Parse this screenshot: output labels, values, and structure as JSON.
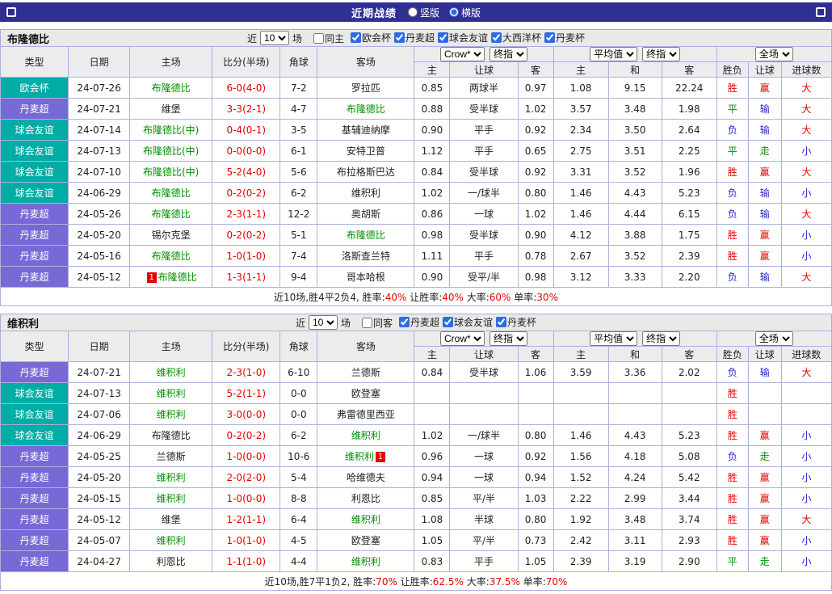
{
  "top_bar": {
    "title": "近期战绩",
    "views": [
      {
        "label": "竖版",
        "selected": false
      },
      {
        "label": "横版",
        "selected": true
      }
    ]
  },
  "icons": {
    "topbar_left": "square-outline-icon",
    "topbar_right": "square-outline-icon"
  },
  "colors": {
    "topbar_bg": "#2f2f94",
    "type_badges": {
      "欧会杯": "#00aca6",
      "丹麦超": "#7769d6",
      "球会友谊": "#00aca6"
    },
    "result_text": {
      "胜": "#e60000",
      "赢": "#e60000",
      "大": "#e60000",
      "平": "#008f00",
      "走": "#008f00",
      "负": "#2424d6",
      "输": "#2424d6",
      "小": "#2424d6"
    },
    "focus_team": "#008f00",
    "score": "#e60000"
  },
  "header_labels": {
    "type": "类型",
    "date": "日期",
    "home": "主场",
    "score": "比分(半场)",
    "corner": "角球",
    "away": "客场",
    "odds_home": "主",
    "odds_handicap": "让球",
    "odds_away": "客",
    "euro_home": "主",
    "euro_draw": "和",
    "euro_away": "客",
    "res_wdl": "胜负",
    "res_handicap": "让球",
    "res_goals": "进球数"
  },
  "sections": [
    {
      "team": "布隆德比",
      "recent": {
        "prefix": "近",
        "count": "10",
        "suffix": "场"
      },
      "venue_filter": {
        "label": "同主",
        "checked": false
      },
      "league_filters": [
        {
          "label": "欧会杯",
          "checked": true
        },
        {
          "label": "丹麦超",
          "checked": true
        },
        {
          "label": "球会友谊",
          "checked": true
        },
        {
          "label": "大西洋杯",
          "checked": true
        },
        {
          "label": "丹麦杯",
          "checked": true
        }
      ],
      "selectors": {
        "odds_source": "Crow*",
        "odds_stage": "终指",
        "euro_source": "平均值",
        "euro_stage": "终指",
        "scope": "全场"
      },
      "rows": [
        {
          "type": "欧会杯",
          "date": "24-07-26",
          "home": {
            "name": "布隆德比",
            "focus": true
          },
          "score": "6-0(4-0)",
          "corner": "7-2",
          "away": {
            "name": "罗拉匹",
            "focus": false
          },
          "odds": [
            "0.85",
            "两球半",
            "0.97",
            "1.08",
            "9.15",
            "22.24"
          ],
          "results": [
            "胜",
            "赢",
            "大"
          ]
        },
        {
          "type": "丹麦超",
          "date": "24-07-21",
          "home": {
            "name": "维堡",
            "focus": false
          },
          "score": "3-3(2-1)",
          "corner": "4-7",
          "away": {
            "name": "布隆德比",
            "focus": true
          },
          "odds": [
            "0.88",
            "受半球",
            "1.02",
            "3.57",
            "3.48",
            "1.98"
          ],
          "results": [
            "平",
            "输",
            "大"
          ]
        },
        {
          "type": "球会友谊",
          "date": "24-07-14",
          "home": {
            "name": "布隆德比(中)",
            "focus": true
          },
          "score": "0-4(0-1)",
          "corner": "3-5",
          "away": {
            "name": "基辅迪纳摩",
            "focus": false
          },
          "odds": [
            "0.90",
            "平手",
            "0.92",
            "2.34",
            "3.50",
            "2.64"
          ],
          "results": [
            "负",
            "输",
            "大"
          ]
        },
        {
          "type": "球会友谊",
          "date": "24-07-13",
          "home": {
            "name": "布隆德比(中)",
            "focus": true
          },
          "score": "0-0(0-0)",
          "corner": "6-1",
          "away": {
            "name": "安特卫普",
            "focus": false
          },
          "odds": [
            "1.12",
            "平手",
            "0.65",
            "2.75",
            "3.51",
            "2.25"
          ],
          "results": [
            "平",
            "走",
            "小"
          ]
        },
        {
          "type": "球会友谊",
          "date": "24-07-10",
          "home": {
            "name": "布隆德比(中)",
            "focus": true
          },
          "score": "5-2(4-0)",
          "corner": "5-6",
          "away": {
            "name": "布拉格斯巴达",
            "focus": false
          },
          "odds": [
            "0.84",
            "受半球",
            "0.92",
            "3.31",
            "3.52",
            "1.96"
          ],
          "results": [
            "胜",
            "赢",
            "大"
          ]
        },
        {
          "type": "球会友谊",
          "date": "24-06-29",
          "home": {
            "name": "布隆德比",
            "focus": true
          },
          "score": "0-2(0-2)",
          "corner": "6-2",
          "away": {
            "name": "维积利",
            "focus": false
          },
          "odds": [
            "1.02",
            "一/球半",
            "0.80",
            "1.46",
            "4.43",
            "5.23"
          ],
          "results": [
            "负",
            "输",
            "小"
          ]
        },
        {
          "type": "丹麦超",
          "date": "24-05-26",
          "home": {
            "name": "布隆德比",
            "focus": true
          },
          "score": "2-3(1-1)",
          "corner": "12-2",
          "away": {
            "name": "奥胡斯",
            "focus": false
          },
          "odds": [
            "0.86",
            "一球",
            "1.02",
            "1.46",
            "4.44",
            "6.15"
          ],
          "results": [
            "负",
            "输",
            "大"
          ]
        },
        {
          "type": "丹麦超",
          "date": "24-05-20",
          "home": {
            "name": "锡尔克堡",
            "focus": false
          },
          "score": "0-2(0-2)",
          "corner": "5-1",
          "away": {
            "name": "布隆德比",
            "focus": true
          },
          "odds": [
            "0.98",
            "受半球",
            "0.90",
            "4.12",
            "3.88",
            "1.75"
          ],
          "results": [
            "胜",
            "赢",
            "小"
          ]
        },
        {
          "type": "丹麦超",
          "date": "24-05-16",
          "home": {
            "name": "布隆德比",
            "focus": true
          },
          "score": "1-0(1-0)",
          "corner": "7-4",
          "away": {
            "name": "洛斯查兰特",
            "focus": false
          },
          "odds": [
            "1.11",
            "平手",
            "0.78",
            "2.67",
            "3.52",
            "2.39"
          ],
          "results": [
            "胜",
            "赢",
            "小"
          ]
        },
        {
          "type": "丹麦超",
          "date": "24-05-12",
          "home": {
            "name": "布隆德比",
            "focus": true,
            "badge": "1",
            "badge_side": "left"
          },
          "score": "1-3(1-1)",
          "corner": "9-4",
          "away": {
            "name": "哥本哈根",
            "focus": false
          },
          "odds": [
            "0.90",
            "受平/半",
            "0.98",
            "3.12",
            "3.33",
            "2.20"
          ],
          "results": [
            "负",
            "输",
            "大"
          ]
        }
      ],
      "summary": [
        {
          "text": "近10场,胜4平2负4, 胜率:",
          "color": "dark"
        },
        {
          "text": "40%",
          "color": "red"
        },
        {
          "text": " 让胜率:",
          "color": "dark"
        },
        {
          "text": "40%",
          "color": "red"
        },
        {
          "text": " 大率:",
          "color": "dark"
        },
        {
          "text": "60%",
          "color": "red"
        },
        {
          "text": " 单率:",
          "color": "dark"
        },
        {
          "text": "30%",
          "color": "red"
        }
      ]
    },
    {
      "team": "维积利",
      "recent": {
        "prefix": "近",
        "count": "10",
        "suffix": "场"
      },
      "venue_filter": {
        "label": "同客",
        "checked": false
      },
      "league_filters": [
        {
          "label": "丹麦超",
          "checked": true
        },
        {
          "label": "球会友谊",
          "checked": true
        },
        {
          "label": "丹麦杯",
          "checked": true
        }
      ],
      "selectors": {
        "odds_source": "Crow*",
        "odds_stage": "终指",
        "euro_source": "平均值",
        "euro_stage": "终指",
        "scope": "全场"
      },
      "rows": [
        {
          "type": "丹麦超",
          "date": "24-07-21",
          "home": {
            "name": "维积利",
            "focus": true
          },
          "score": "2-3(1-0)",
          "corner": "6-10",
          "away": {
            "name": "兰德斯",
            "focus": false
          },
          "odds": [
            "0.84",
            "受半球",
            "1.06",
            "3.59",
            "3.36",
            "2.02"
          ],
          "results": [
            "负",
            "输",
            "大"
          ]
        },
        {
          "type": "球会友谊",
          "date": "24-07-13",
          "home": {
            "name": "维积利",
            "focus": true
          },
          "score": "5-2(1-1)",
          "corner": "0-0",
          "away": {
            "name": "欧登塞",
            "focus": false
          },
          "odds": [
            "",
            "",
            "",
            "",
            "",
            ""
          ],
          "results": [
            "胜",
            "",
            ""
          ]
        },
        {
          "type": "球会友谊",
          "date": "24-07-06",
          "home": {
            "name": "维积利",
            "focus": true
          },
          "score": "3-0(0-0)",
          "corner": "0-0",
          "away": {
            "name": "弗雷德里西亚",
            "focus": false
          },
          "odds": [
            "",
            "",
            "",
            "",
            "",
            ""
          ],
          "results": [
            "胜",
            "",
            ""
          ]
        },
        {
          "type": "球会友谊",
          "date": "24-06-29",
          "home": {
            "name": "布隆德比",
            "focus": false
          },
          "score": "0-2(0-2)",
          "corner": "6-2",
          "away": {
            "name": "维积利",
            "focus": true
          },
          "odds": [
            "1.02",
            "一/球半",
            "0.80",
            "1.46",
            "4.43",
            "5.23"
          ],
          "results": [
            "胜",
            "赢",
            "小"
          ]
        },
        {
          "type": "丹麦超",
          "date": "24-05-25",
          "home": {
            "name": "兰德斯",
            "focus": false
          },
          "score": "1-0(0-0)",
          "corner": "10-6",
          "away": {
            "name": "维积利",
            "focus": true,
            "badge": "1",
            "badge_side": "right"
          },
          "odds": [
            "0.96",
            "一球",
            "0.92",
            "1.56",
            "4.18",
            "5.08"
          ],
          "results": [
            "负",
            "走",
            "小"
          ]
        },
        {
          "type": "丹麦超",
          "date": "24-05-20",
          "home": {
            "name": "维积利",
            "focus": true
          },
          "score": "2-0(2-0)",
          "corner": "5-4",
          "away": {
            "name": "哈维德夫",
            "focus": false
          },
          "odds": [
            "0.94",
            "一球",
            "0.94",
            "1.52",
            "4.24",
            "5.42"
          ],
          "results": [
            "胜",
            "赢",
            "小"
          ]
        },
        {
          "type": "丹麦超",
          "date": "24-05-15",
          "home": {
            "name": "维积利",
            "focus": true
          },
          "score": "1-0(0-0)",
          "corner": "8-8",
          "away": {
            "name": "利恩比",
            "focus": false
          },
          "odds": [
            "0.85",
            "平/半",
            "1.03",
            "2.22",
            "2.99",
            "3.44"
          ],
          "results": [
            "胜",
            "赢",
            "小"
          ]
        },
        {
          "type": "丹麦超",
          "date": "24-05-12",
          "home": {
            "name": "维堡",
            "focus": false
          },
          "score": "1-2(1-1)",
          "corner": "6-4",
          "away": {
            "name": "维积利",
            "focus": true
          },
          "odds": [
            "1.08",
            "半球",
            "0.80",
            "1.92",
            "3.48",
            "3.74"
          ],
          "results": [
            "胜",
            "赢",
            "大"
          ]
        },
        {
          "type": "丹麦超",
          "date": "24-05-07",
          "home": {
            "name": "维积利",
            "focus": true
          },
          "score": "1-0(1-0)",
          "corner": "4-5",
          "away": {
            "name": "欧登塞",
            "focus": false
          },
          "odds": [
            "1.05",
            "平/半",
            "0.73",
            "2.42",
            "3.11",
            "2.93"
          ],
          "results": [
            "胜",
            "赢",
            "小"
          ]
        },
        {
          "type": "丹麦超",
          "date": "24-04-27",
          "home": {
            "name": "利恩比",
            "focus": false
          },
          "score": "1-1(1-0)",
          "corner": "4-4",
          "away": {
            "name": "维积利",
            "focus": true
          },
          "odds": [
            "0.83",
            "平手",
            "1.05",
            "2.39",
            "3.19",
            "2.90"
          ],
          "results": [
            "平",
            "走",
            "小"
          ]
        }
      ],
      "summary": [
        {
          "text": "近10场,胜7平1负2, 胜率:",
          "color": "dark"
        },
        {
          "text": "70%",
          "color": "red"
        },
        {
          "text": " 让胜率:",
          "color": "dark"
        },
        {
          "text": "62.5%",
          "color": "red"
        },
        {
          "text": " 大率:",
          "color": "dark"
        },
        {
          "text": "37.5%",
          "color": "red"
        },
        {
          "text": " 单率:",
          "color": "dark"
        },
        {
          "text": "70%",
          "color": "red"
        }
      ]
    }
  ]
}
